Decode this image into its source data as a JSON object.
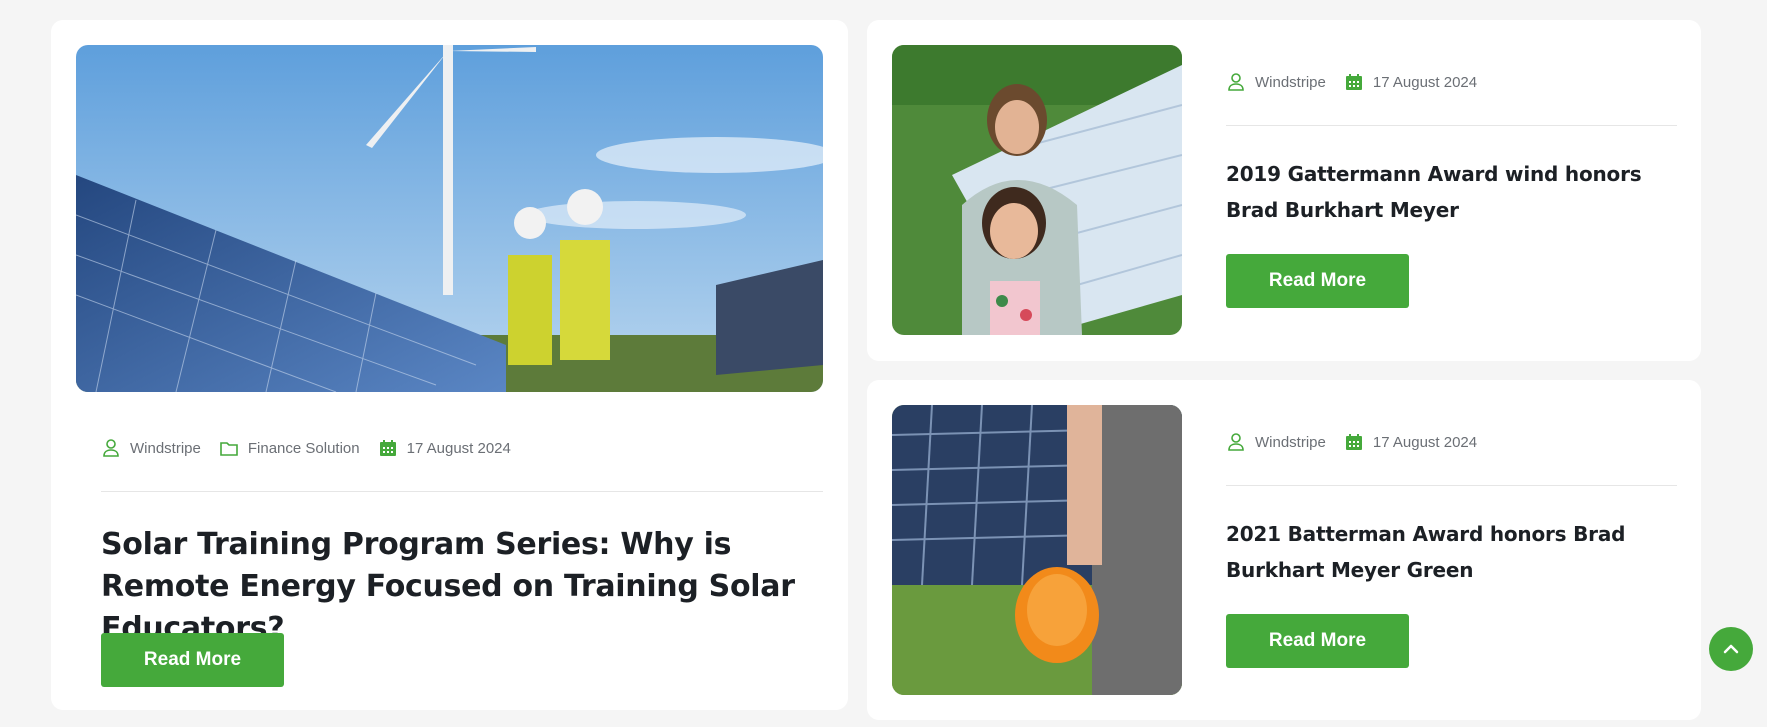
{
  "colors": {
    "accent": "#45a93b",
    "background": "#f5f5f5",
    "card": "#ffffff",
    "meta_text": "#6b6f75"
  },
  "featured": {
    "author": "Windstripe",
    "category": "Finance Solution",
    "date": "17 August 2024",
    "title": "Solar Training Program Series: Why is Remote Energy Focused on Training Solar Educators?",
    "button": "Read More"
  },
  "posts": [
    {
      "author": "Windstripe",
      "date": "17 August 2024",
      "title": "2019 Gattermann Award wind honors Brad Burkhart Meyer",
      "button": "Read More"
    },
    {
      "author": "Windstripe",
      "date": "17 August 2024",
      "title": "2021 Batterman Award honors Brad Burkhart Meyer Green",
      "button": "Read More"
    }
  ],
  "icons": {
    "author": "user-icon",
    "category": "folder-icon",
    "date": "calendar-icon",
    "scroll_top": "chevron-up-icon"
  }
}
